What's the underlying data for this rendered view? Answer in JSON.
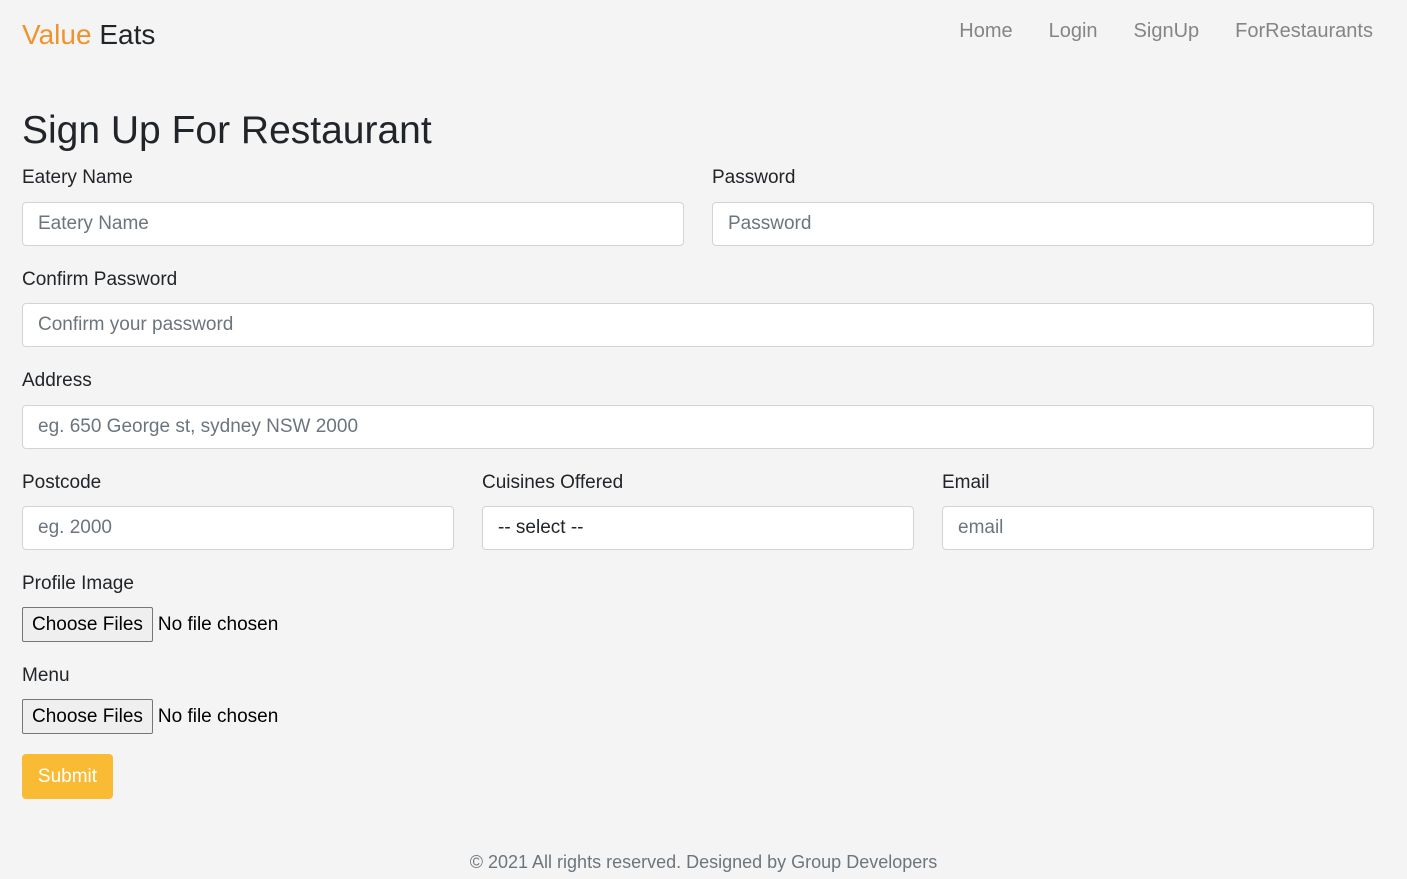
{
  "brand": {
    "part1": "Value",
    "part2": "Eats"
  },
  "nav": {
    "home": "Home",
    "login": "Login",
    "signup": "SignUp",
    "for_restaurants": "ForRestaurants"
  },
  "page_title": "Sign Up For Restaurant",
  "form": {
    "eatery_name": {
      "label": "Eatery Name",
      "placeholder": "Eatery Name"
    },
    "password": {
      "label": "Password",
      "placeholder": "Password"
    },
    "confirm_password": {
      "label": "Confirm Password",
      "placeholder": "Confirm your password"
    },
    "address": {
      "label": "Address",
      "placeholder": "eg. 650 George st, sydney NSW 2000"
    },
    "postcode": {
      "label": "Postcode",
      "placeholder": "eg. 2000"
    },
    "cuisines": {
      "label": "Cuisines Offered",
      "selected": "-- select --"
    },
    "email": {
      "label": "Email",
      "placeholder": "email"
    },
    "profile_image": {
      "label": "Profile Image",
      "button": "Choose Files",
      "status": "No file chosen"
    },
    "menu": {
      "label": "Menu",
      "button": "Choose Files",
      "status": "No file chosen"
    },
    "submit": "Submit"
  },
  "footer": "© 2021 All rights reserved. Designed by Group Developers",
  "colors": {
    "brand_accent": "#f0932b",
    "submit_bg": "#f8bb33",
    "background": "#f4f4f4"
  }
}
